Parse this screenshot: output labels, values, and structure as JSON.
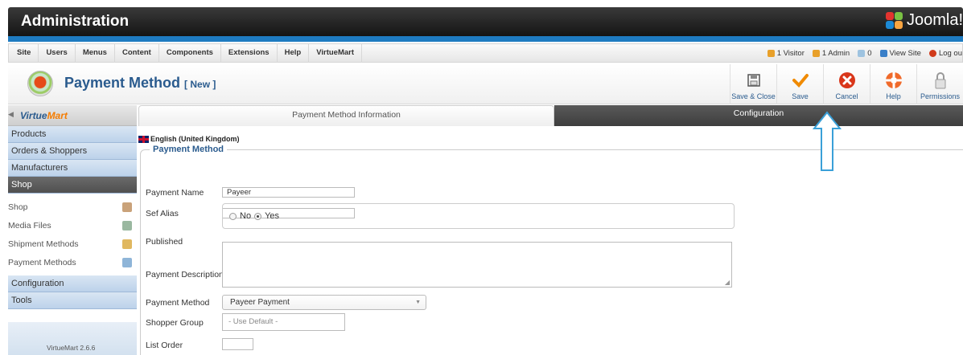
{
  "header": {
    "title": "Administration",
    "brand": "Joomla!"
  },
  "menubar": {
    "items": [
      "Site",
      "Users",
      "Menus",
      "Content",
      "Components",
      "Extensions",
      "Help",
      "VirtueMart"
    ],
    "status": {
      "visitors": "1 Visitor",
      "admins": "1 Admin",
      "messages": "0",
      "view_site": "View Site",
      "logout": "Log ou"
    }
  },
  "toolbar": {
    "title": "Payment Method",
    "subtitle": "[ New ]",
    "buttons": [
      {
        "label": "Save & Close",
        "icon": "save-icon"
      },
      {
        "label": "Save",
        "icon": "check-icon"
      },
      {
        "label": "Cancel",
        "icon": "cancel-icon"
      },
      {
        "label": "Help",
        "icon": "help-icon"
      },
      {
        "label": "Permissions",
        "icon": "lock-icon"
      }
    ]
  },
  "sidebar": {
    "logo": {
      "part1": "Virtue",
      "part2": "Mart"
    },
    "top_items": [
      "Products",
      "Orders & Shoppers",
      "Manufacturers",
      "Shop"
    ],
    "sub_items": [
      "Shop",
      "Media Files",
      "Shipment Methods",
      "Payment Methods"
    ],
    "bottom_items": [
      "Configuration",
      "Tools"
    ],
    "version": "VirtueMart 2.6.6"
  },
  "tabs": [
    "Payment Method Information",
    "Configuration"
  ],
  "form": {
    "language": "English (United Kingdom)",
    "legend": "Payment Method",
    "payment_name": {
      "label": "Payment Name",
      "value": "Payeer"
    },
    "sef_alias": {
      "label": "Sef Alias",
      "value": ""
    },
    "published": {
      "label": "Published",
      "no": "No",
      "yes": "Yes"
    },
    "description": {
      "label": "Payment Description"
    },
    "payment_method": {
      "label": "Payment Method",
      "value": "Payeer Payment"
    },
    "shopper_group": {
      "label": "Shopper Group",
      "value": "- Use Default -"
    },
    "list_order": {
      "label": "List Order",
      "value": ""
    }
  },
  "colors": {
    "accent": "#1e7bc1",
    "title": "#2a5b8e",
    "annotation": "#3aa0d8"
  }
}
